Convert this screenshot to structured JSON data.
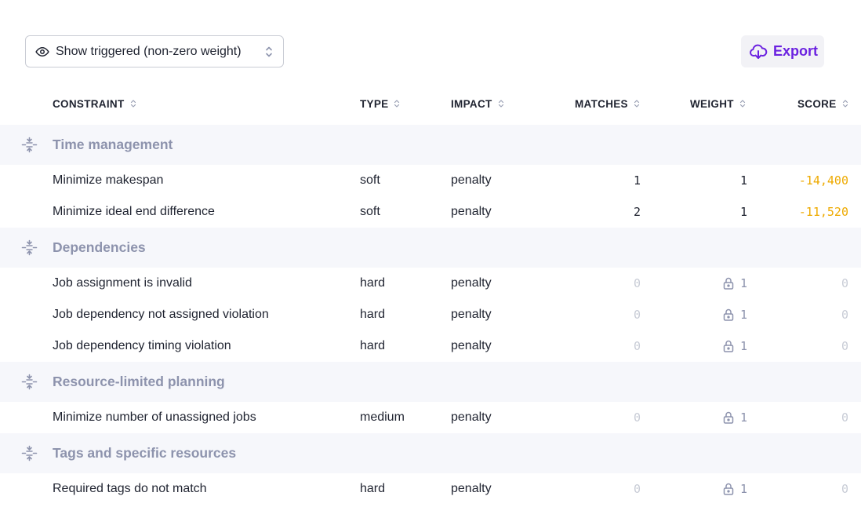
{
  "toolbar": {
    "filter": {
      "value": "Show triggered (non-zero weight)",
      "icon": "eye-icon"
    },
    "export": {
      "label": "Export",
      "icon": "cloud-download-icon",
      "color": "#6b21e0"
    }
  },
  "table": {
    "columns": [
      "CONSTRAINT",
      "TYPE",
      "IMPACT",
      "MATCHES",
      "WEIGHT",
      "SCORE"
    ],
    "groups": [
      {
        "name": "Time management",
        "rows": [
          {
            "name": "Minimize makespan",
            "type": "soft",
            "impact": "penalty",
            "matches": "1",
            "weight": "1",
            "locked": false,
            "score": "-14,400"
          },
          {
            "name": "Minimize ideal end difference",
            "type": "soft",
            "impact": "penalty",
            "matches": "2",
            "weight": "1",
            "locked": false,
            "score": "-11,520"
          }
        ]
      },
      {
        "name": "Dependencies",
        "rows": [
          {
            "name": "Job assignment is invalid",
            "type": "hard",
            "impact": "penalty",
            "matches": "0",
            "weight": "1",
            "locked": true,
            "score": "0"
          },
          {
            "name": "Job dependency not assigned violation",
            "type": "hard",
            "impact": "penalty",
            "matches": "0",
            "weight": "1",
            "locked": true,
            "score": "0"
          },
          {
            "name": "Job dependency timing violation",
            "type": "hard",
            "impact": "penalty",
            "matches": "0",
            "weight": "1",
            "locked": true,
            "score": "0"
          }
        ]
      },
      {
        "name": "Resource-limited planning",
        "rows": [
          {
            "name": "Minimize number of unassigned jobs",
            "type": "medium",
            "impact": "penalty",
            "matches": "0",
            "weight": "1",
            "locked": true,
            "score": "0"
          }
        ]
      },
      {
        "name": "Tags and specific resources",
        "rows": [
          {
            "name": "Required tags do not match",
            "type": "hard",
            "impact": "penalty",
            "matches": "0",
            "weight": "1",
            "locked": true,
            "score": "0"
          }
        ]
      }
    ]
  },
  "colors": {
    "group_bg": "#f6f7fb",
    "group_text": "#8d93ad",
    "score_negative": "#eeaa00",
    "muted_number": "#c8ccd6"
  }
}
